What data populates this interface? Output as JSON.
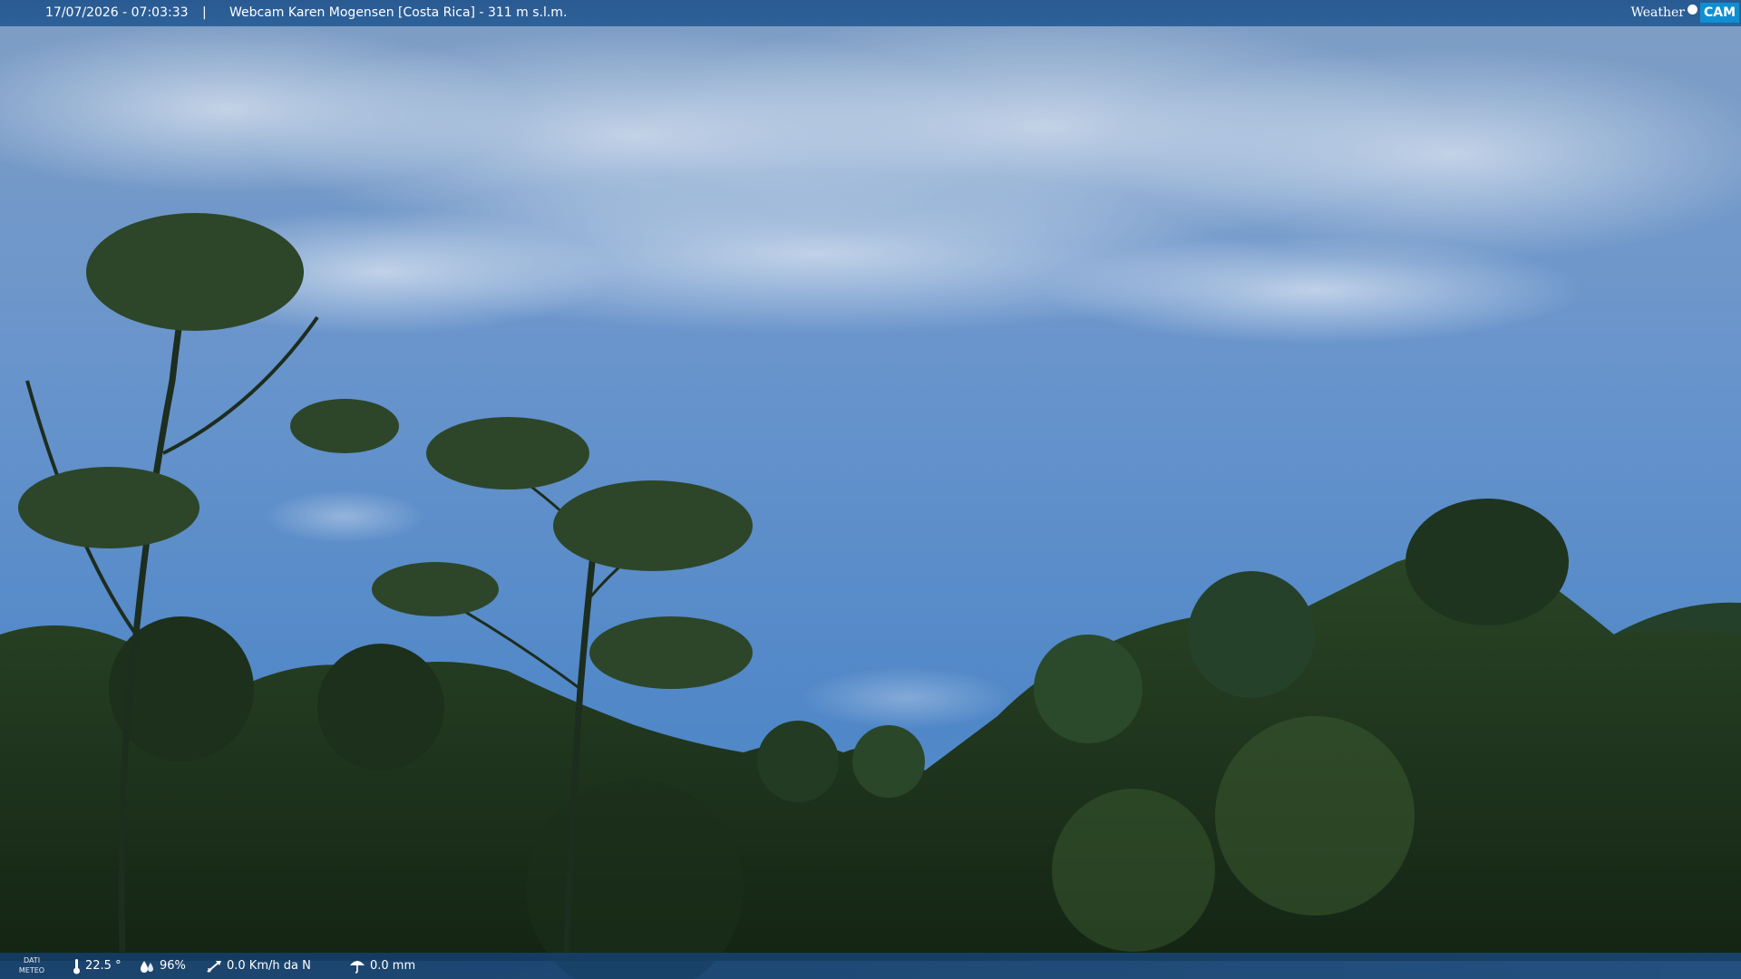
{
  "header": {
    "datetime": "17/07/2026 - 07:03:33",
    "separator": "|",
    "camera_title": "Webcam Karen Mogensen [Costa Rica]  - 311 m s.l.m.",
    "logo_weather": "Weather",
    "logo_cam": "CAM"
  },
  "weather": {
    "label_line1": "DATI",
    "label_line2": "METEO",
    "temperature": "22.5 °",
    "humidity": "96%",
    "wind": "0.0 Km/h da N",
    "rain": "0.0 mm",
    "temperature_icon": "thermometer-icon",
    "humidity_icon": "humidity-drops-icon",
    "wind_icon": "wind-vane-icon",
    "rain_icon": "umbrella-icon"
  },
  "colors": {
    "sky_top": "#8fb0d4",
    "sky_bottom": "#4f86c6",
    "forest": "#1f3420",
    "bar": "#2b5c94"
  }
}
